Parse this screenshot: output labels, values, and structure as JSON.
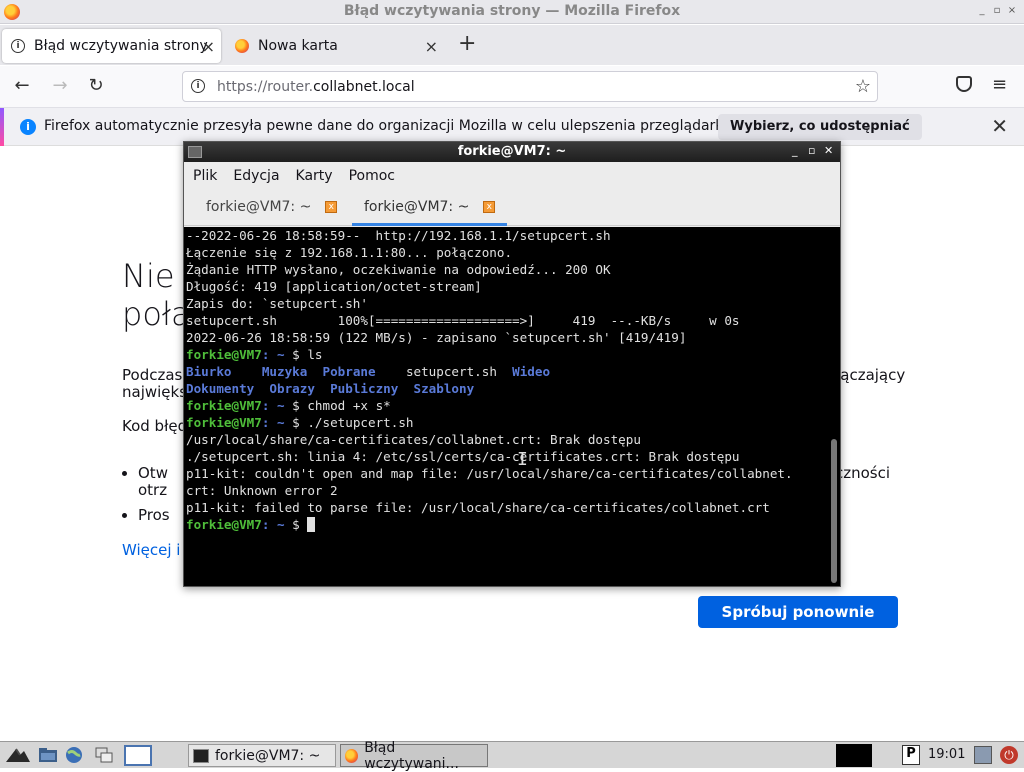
{
  "firefox": {
    "window_title": "Błąd wczytywania strony — Mozilla Firefox",
    "tabs": [
      {
        "label": "Błąd wczytywania strony",
        "close": "×"
      },
      {
        "label": "Nowa karta",
        "close": "×"
      }
    ],
    "new_tab_symbol": "+",
    "nav": {
      "back": "←",
      "forward": "→",
      "reload": "↻"
    },
    "url": {
      "prefix": "https://router.",
      "domain": "collabnet.local"
    },
    "notification": {
      "text": "Firefox automatycznie przesyła pewne dane do organizacji Mozilla w celu ulepszenia przeglądarki.",
      "button": "Wybierz, co udostępniać",
      "close": "✕"
    }
  },
  "error_page": {
    "title_line1": "Nie",
    "title_line2": "połą",
    "desc_start": "Podczas",
    "desc_line2": "największ",
    "desc_end": "łączający",
    "code_label": "Kod błęd",
    "item1_start": "Otw",
    "item1_line2": "otrz",
    "item1_end": "czności",
    "item2": "Pros",
    "more_link": "Więcej i",
    "retry_button": "Spróbuj ponownie"
  },
  "terminal": {
    "window_title": "forkie@VM7: ~",
    "menu": [
      "Plik",
      "Edycja",
      "Karty",
      "Pomoc"
    ],
    "tabs": [
      {
        "label": "forkie@VM7: ~",
        "close": "x"
      },
      {
        "label": "forkie@VM7: ~",
        "close": "x"
      }
    ],
    "lines": {
      "l1": "--2022-06-26 18:58:59--  http://192.168.1.1/setupcert.sh",
      "l2": "Łączenie się z 192.168.1.1:80... połączono.",
      "l3": "Żądanie HTTP wysłano, oczekiwanie na odpowiedź... 200 OK",
      "l4": "Długość: 419 [application/octet-stream]",
      "l5": "Zapis do: `setupcert.sh'",
      "l6": "",
      "l7": "setupcert.sh        100%[===================>]     419  --.-KB/s     w 0s",
      "l8": "",
      "l9": "2022-06-26 18:58:59 (122 MB/s) - zapisano `setupcert.sh' [419/419]",
      "l10": "",
      "prompt_user": "forkie@VM7",
      "prompt_sep": ": ~",
      "cmd1": "$ ls",
      "ls_row1": [
        "Biurko",
        "Muzyka",
        "Pobrane",
        "setupcert.sh",
        "Wideo"
      ],
      "ls_row2": [
        "Dokumenty",
        "Obrazy",
        "Publiczny",
        "Szablony"
      ],
      "cmd2": "$ chmod +x s*",
      "cmd3": "$ ./setupcert.sh",
      "e1": "/usr/local/share/ca-certificates/collabnet.crt: Brak dostępu",
      "e2": "./setupcert.sh: linia 4: /etc/ssl/certs/ca-certificates.crt: Brak dostępu",
      "e3": "p11-kit: couldn't open and map file: /usr/local/share/ca-certificates/collabnet.",
      "e4": "crt: Unknown error 2",
      "e5": "p11-kit: failed to parse file: /usr/local/share/ca-certificates/collabnet.crt",
      "cmd4": "$ "
    }
  },
  "taskbar": {
    "tasks": [
      {
        "label": "forkie@VM7: ~"
      },
      {
        "label": "Błąd wczytywani..."
      }
    ],
    "clock": "19:01"
  },
  "colors": {
    "accent_blue": "#0061e0",
    "prompt_green": "#4fbf3a",
    "dir_blue": "#5a7ad8"
  }
}
